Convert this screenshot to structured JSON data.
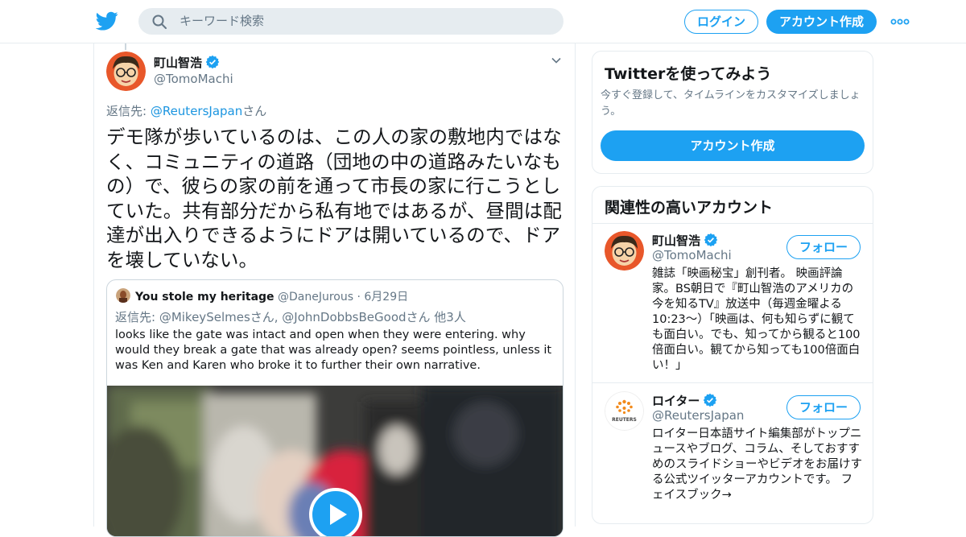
{
  "header": {
    "search_placeholder": "キーワード検索",
    "login_label": "ログイン",
    "signup_label": "アカウント作成"
  },
  "tweet": {
    "author_name": "町山智浩",
    "author_handle": "@TomoMachi",
    "reply_prefix": "返信先: ",
    "reply_link": "@ReutersJapan",
    "reply_suffix": "さん",
    "text": "デモ隊が歩いているのは、この人の家の敷地内ではなく、コミュニティの道路（団地の中の道路みたいなもの）で、彼らの家の前を通って市長の家に行こうとしていた。共有部分だから私有地ではあるが、昼間は配達が出入りできるようにドアは開いているので、ドアを壊していない。"
  },
  "quote": {
    "author_name": "You stole my heritage",
    "author_handle": "@DaneJurous",
    "separator": "·",
    "date": "6月29日",
    "reply_line": "返信先: @MikeySelmesさん, @JohnDobbsBeGoodさん 他3人",
    "text": "looks like the gate was intact and open when they were entering. why would they break a gate that was already open? seems pointless, unless it was Ken and Karen who broke it to further their own narrative."
  },
  "sidebar": {
    "signup_card": {
      "title": "Twitterを使ってみよう",
      "description": "今すぐ登録して、タイムラインをカスタマイズしましょう。",
      "button_label": "アカウント作成"
    },
    "related": {
      "title": "関連性の高いアカウント",
      "accounts": [
        {
          "name": "町山智浩",
          "handle": "@TomoMachi",
          "follow_label": "フォロー",
          "bio": "雑誌「映画秘宝」創刊者。 映画評論家。BS朝日で『町山智浩のアメリカの今を知るTV』放送中（毎週金曜よる10:23〜）「映画は、何も知らずに観ても面白い。でも、知ってから観ると100倍面白い。観てから知っても100倍面白い！」"
        },
        {
          "name": "ロイター",
          "handle": "@ReutersJapan",
          "follow_label": "フォロー",
          "logo_text": "REUTERS",
          "bio": "ロイター日本語サイト編集部がトップニュースやブログ、コラム、そしておすすめのスライドショーやビデオをお届けする公式ツイッターアカウントです。 フェイスブック→"
        }
      ]
    }
  },
  "colors": {
    "brand_blue": "#1da1f2",
    "link_blue": "#1b95e0",
    "secondary_text": "#657786",
    "border": "#e6ecf0"
  }
}
